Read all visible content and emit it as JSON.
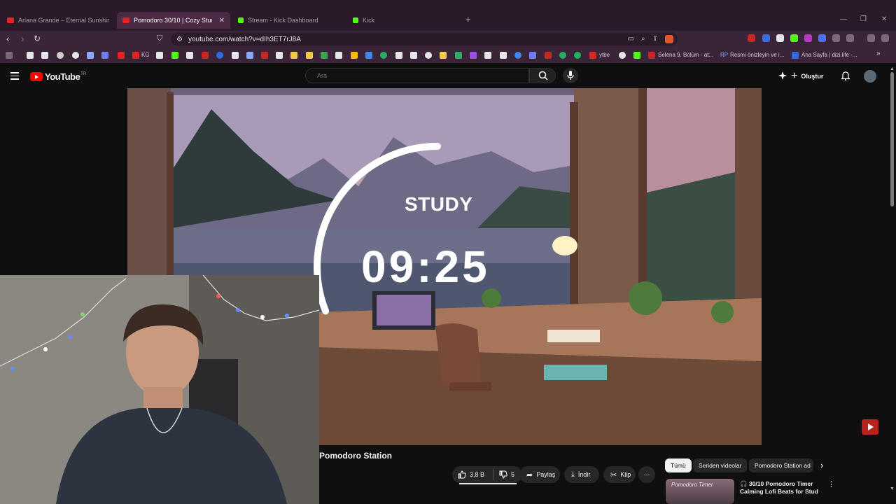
{
  "browser": {
    "tabs": [
      {
        "label": "Ariana Grande – Eternal Sunshine | P",
        "active": false
      },
      {
        "label": "Pomodoro 30/10 | Cozy Stud",
        "active": true
      },
      {
        "label": "Stream - Kick Dashboard",
        "active": false
      },
      {
        "label": "Kick",
        "active": false
      }
    ],
    "close_glyph": "✕",
    "new_tab_glyph": "+",
    "url": "youtube.com/watch?v=dIh3ET7rJ8A",
    "bookmarks": {
      "kg": "KG",
      "ytbe": "ytbe",
      "selena": "Selena 9. Bölüm - at...",
      "rp": "Resmi önizleyin ve i...",
      "anasayfa": "Ana Sayfa | dizi.life -..."
    }
  },
  "youtube": {
    "logo_text": "YouTube",
    "logo_region": "TR",
    "search_placeholder": "Ara",
    "create_label": "Oluştur"
  },
  "video": {
    "overlay_label": "STUDY",
    "timer": "09:25",
    "progress_ring": 0.31,
    "colors": {
      "ring": "#ffffff"
    }
  },
  "channel": {
    "name": "Pomodoro Station"
  },
  "actions": {
    "likes": "3,8 B",
    "dislikes": "5",
    "share": "Paylaş",
    "download": "İndir",
    "clip": "Klip",
    "more": "⋯"
  },
  "chips": [
    "Tümü",
    "Seriden videolar",
    "Pomodoro Station ad"
  ],
  "recommendation": {
    "title_line1": "30/10 Pomodoro Timer",
    "title_line2": "Calming Lofi Beats for Stud",
    "thumb_text": "Pomodoro Timer"
  },
  "colors": {
    "brand": "#ff0000",
    "bg": "#0f0f0f",
    "chrome": "#3a2437"
  }
}
